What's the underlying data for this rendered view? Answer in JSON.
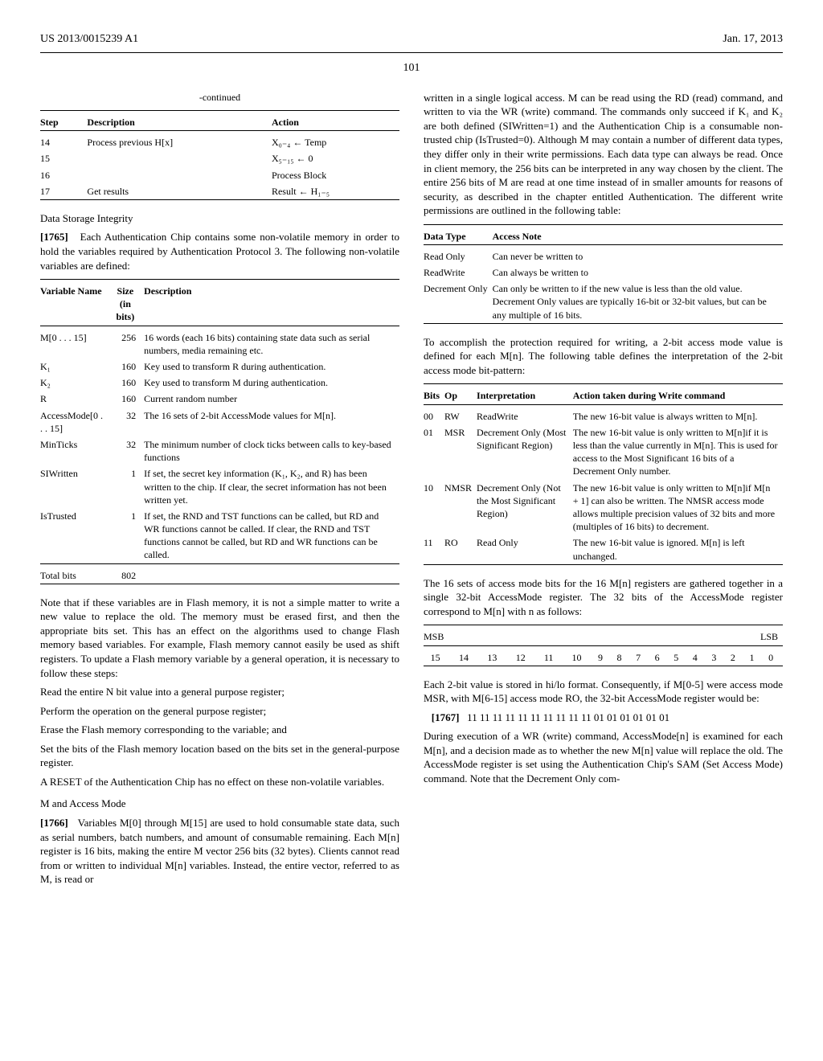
{
  "header": {
    "left": "US 2013/0015239 A1",
    "right": "Jan. 17, 2013"
  },
  "page_number": "101",
  "left_col": {
    "table_continued": {
      "caption": "-continued",
      "headers": [
        "Step",
        "Description",
        "Action"
      ],
      "rows": [
        {
          "step": "14",
          "desc": "Process previous H[x]",
          "action": "X₀₋₄ ← Temp"
        },
        {
          "step": "15",
          "desc": "",
          "action": "X₅₋₁₅ ← 0"
        },
        {
          "step": "16",
          "desc": "",
          "action": "Process Block"
        },
        {
          "step": "17",
          "desc": "Get results",
          "action": "Result ← H₁₋₅"
        }
      ]
    },
    "heading1": "Data Storage Integrity",
    "p1765_num": "[1765]",
    "p1765": "Each Authentication Chip contains some non-volatile memory in order to hold the variables required by Authentication Protocol 3. The following non-volatile variables are defined:",
    "vars_table": {
      "headers": [
        "Variable Name",
        "Size (in bits)",
        "Description"
      ],
      "rows": [
        {
          "name": "M[0 . . . 15]",
          "size": "256",
          "desc": "16 words (each 16 bits) containing state data such as serial numbers, media remaining etc."
        },
        {
          "name": "K₁",
          "size": "160",
          "desc": "Key used to transform R during authentication."
        },
        {
          "name": "K₂",
          "size": "160",
          "desc": "Key used to transform M during authentication."
        },
        {
          "name": "R",
          "size": "160",
          "desc": "Current random number"
        },
        {
          "name": "AccessMode[0 . . . 15]",
          "size": "32",
          "desc": "The 16 sets of 2-bit AccessMode values for M[n]."
        },
        {
          "name": "MinTicks",
          "size": "32",
          "desc": "The minimum number of clock ticks between calls to key-based functions"
        },
        {
          "name": "SIWritten",
          "size": "1",
          "desc": "If set, the secret key information (K₁, K₂, and R) has been written to the chip. If clear, the secret information has not been written yet."
        },
        {
          "name": "IsTrusted",
          "size": "1",
          "desc": "If set, the RND and TST functions can be called, but RD and WR functions cannot be called. If clear, the RND and TST functions cannot be called, but RD and WR functions can be called."
        }
      ],
      "total_label": "Total bits",
      "total_value": "802"
    },
    "p_note1": "Note that if these variables are in Flash memory, it is not a simple matter to write a new value to replace the old. The memory must be erased first, and then the appropriate bits set. This has an effect on the algorithms used to change Flash memory based variables. For example, Flash memory cannot easily be used as shift registers. To update a Flash memory variable by a general operation, it is necessary to follow these steps:",
    "steps_a": "Read the entire N bit value into a general purpose register;",
    "steps_b": "Perform the operation on the general purpose register;",
    "steps_c": "Erase the Flash memory corresponding to the variable; and",
    "steps_d": "Set the bits of the Flash memory location based on the bits set in the general-purpose register.",
    "p_reset": "A RESET of the Authentication Chip has no effect on these non-volatile variables.",
    "heading2": "M and Access Mode",
    "p1766_num": "[1766]",
    "p1766": "Variables M[0] through M[15] are used to hold consumable state data, such as serial numbers, batch numbers, and amount of consumable remaining. Each M[n] register is 16 bits, making the entire M vector 256 bits (32 bytes). Clients cannot read from or written to individual M[n] variables. Instead, the entire vector, referred to as M, is read or"
  },
  "right_col": {
    "p_cont": "written in a single logical access. M can be read using the RD (read) command, and written to via the WR (write) command. The commands only succeed if K₁ and K₂ are both defined (SIWritten=1) and the Authentication Chip is a consumable non-trusted chip (IsTrusted=0). Although M may contain a number of different data types, they differ only in their write permissions. Each data type can always be read. Once in client memory, the 256 bits can be interpreted in any way chosen by the client. The entire 256 bits of M are read at one time instead of in smaller amounts for reasons of security, as described in the chapter entitled Authentication. The different write permissions are outlined in the following table:",
    "perm_table": {
      "headers": [
        "Data Type",
        "Access Note"
      ],
      "rows": [
        {
          "type": "Read Only",
          "note": "Can never be written to"
        },
        {
          "type": "ReadWrite",
          "note": "Can always be written to"
        },
        {
          "type": "Decrement Only",
          "note": "Can only be written to if the new value is less than the old value. Decrement Only values are typically 16-bit or 32-bit values, but can be any multiple of 16 bits."
        }
      ]
    },
    "p_2bit": "To accomplish the protection required for writing, a 2-bit access mode value is defined for each M[n]. The following table defines the interpretation of the 2-bit access mode bit-pattern:",
    "bits_table": {
      "headers": [
        "Bits",
        "Op",
        "Interpretation",
        "Action taken during Write command"
      ],
      "rows": [
        {
          "bits": "00",
          "op": "RW",
          "interp": "ReadWrite",
          "action": "The new 16-bit value is always written to M[n]."
        },
        {
          "bits": "01",
          "op": "MSR",
          "interp": "Decrement Only (Most Significant Region)",
          "action": "The new 16-bit value is only written to M[n]if it is less than the value currently in M[n]. This is used for access to the Most Significant 16 bits of a Decrement Only number."
        },
        {
          "bits": "10",
          "op": "NMSR",
          "interp": "Decrement Only (Not the Most Significant Region)",
          "action": "The new 16-bit value is only written to M[n]if M[n + 1] can also be written. The NMSR access mode allows multiple precision values of 32 bits and more (multiples of 16 bits) to decrement."
        },
        {
          "bits": "11",
          "op": "RO",
          "interp": "Read Only",
          "action": "The new 16-bit value is ignored. M[n] is left unchanged."
        }
      ]
    },
    "p_16sets": "The 16 sets of access mode bits for the 16 M[n] registers are gathered together in a single 32-bit AccessMode register. The 32 bits of the AccessMode register correspond to M[n] with n as follows:",
    "msb_lsb": {
      "msb": "MSB",
      "lsb": "LSB",
      "values": [
        "15",
        "14",
        "13",
        "12",
        "11",
        "10",
        "9",
        "8",
        "7",
        "6",
        "5",
        "4",
        "3",
        "2",
        "1",
        "0"
      ]
    },
    "p_hilo": "Each 2-bit value is stored in hi/lo format. Consequently, if M[0-5] were access mode MSR, with M[6-15] access mode RO, the 32-bit AccessMode register would be:",
    "p1767_num": "[1767]",
    "p1767_bits": "11 11 11 11 11 11 11 11 11 11 01 01 01 01 01 01",
    "p_exec": "During execution of a WR (write) command, AccessMode[n] is examined for each M[n], and a decision made as to whether the new M[n] value will replace the old. The AccessMode register is set using the Authentication Chip's SAM (Set Access Mode) command. Note that the Decrement Only com-"
  }
}
